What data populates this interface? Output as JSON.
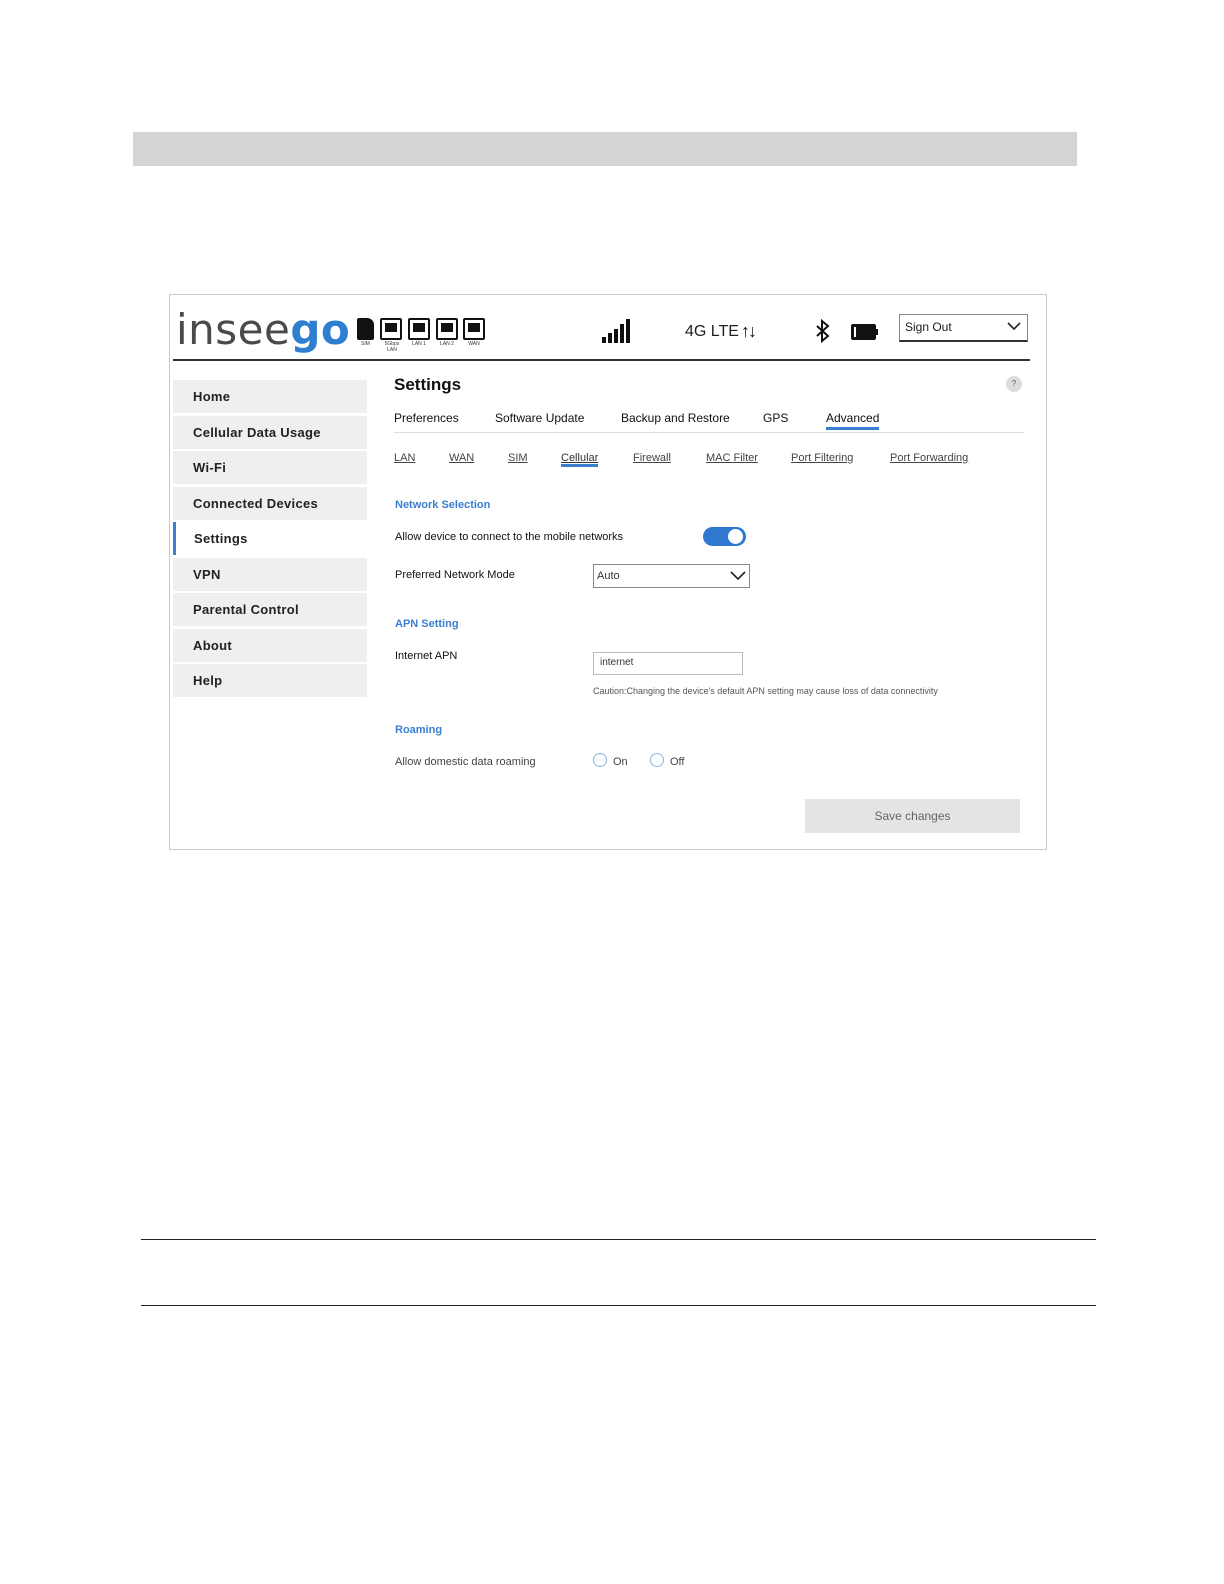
{
  "header": {
    "logo_left": "insee",
    "logo_right": "go",
    "ports": [
      {
        "name": "sim",
        "caption": "SIM"
      },
      {
        "name": "lan-5ghz",
        "caption": "5Gbps LAN"
      },
      {
        "name": "lan1",
        "caption": "LAN 1"
      },
      {
        "name": "lan2",
        "caption": "LAN 2"
      },
      {
        "name": "wan",
        "caption": "WAN"
      }
    ],
    "network_type": "4G LTE",
    "transfer_arrows": "↑↓",
    "signout_label": "Sign Out"
  },
  "sidebar": {
    "items": [
      {
        "label": "Home"
      },
      {
        "label": "Cellular Data Usage"
      },
      {
        "label": "Wi-Fi"
      },
      {
        "label": "Connected Devices"
      },
      {
        "label": "Settings",
        "active": true
      },
      {
        "label": "VPN"
      },
      {
        "label": "Parental Control"
      },
      {
        "label": "About"
      },
      {
        "label": "Help"
      }
    ]
  },
  "main": {
    "title": "Settings",
    "help_icon": "?",
    "tabs": [
      "Preferences",
      "Software Update",
      "Backup and Restore",
      "GPS",
      "Advanced"
    ],
    "active_tab": "Advanced",
    "subtabs": [
      "LAN",
      "WAN",
      "SIM",
      "Cellular",
      "Firewall",
      "MAC Filter",
      "Port Filtering",
      "Port Forwarding"
    ],
    "active_subtab": "Cellular",
    "network_selection": {
      "heading": "Network Selection",
      "allow_label": "Allow device to connect to the mobile networks",
      "allow_enabled": true,
      "mode_label": "Preferred Network Mode",
      "mode_value": "Auto"
    },
    "apn": {
      "heading": "APN Setting",
      "label": "Internet APN",
      "value": "internet",
      "caution": "Caution:Changing the device's default APN setting may cause loss of data connectivity"
    },
    "roaming": {
      "heading": "Roaming",
      "label": "Allow domestic data roaming",
      "on_label": "On",
      "off_label": "Off"
    },
    "save_label": "Save changes"
  },
  "colors": {
    "accent": "#3a7fd0",
    "logo_gray": "#4a4a4a",
    "sidebar_bg": "#efefef",
    "band": "#d4d4d4"
  }
}
